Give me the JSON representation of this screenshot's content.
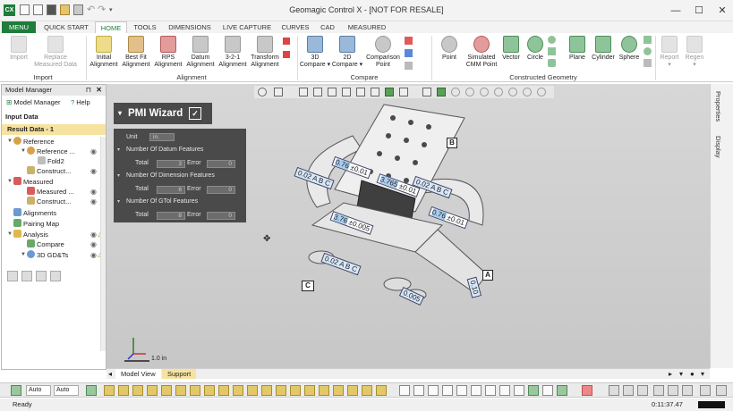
{
  "window": {
    "title": "Geomagic Control X - [NOT FOR RESALE]",
    "app_icon": "CX"
  },
  "tabs": {
    "menu": "MENU",
    "items": [
      "QUICK START",
      "HOME",
      "TOOLS",
      "DIMENSIONS",
      "LIVE CAPTURE",
      "CURVES",
      "CAD",
      "MEASURED"
    ],
    "active": "HOME"
  },
  "ribbon": {
    "import": {
      "label": "Import",
      "buttons": [
        {
          "label1": "Import",
          "label2": ""
        },
        {
          "label1": "Replace",
          "label2": "Measured Data"
        }
      ]
    },
    "alignment": {
      "label": "Alignment",
      "buttons": [
        {
          "label1": "Initial",
          "label2": "Alignment"
        },
        {
          "label1": "Best Fit",
          "label2": "Alignment"
        },
        {
          "label1": "RPS",
          "label2": "Alignment"
        },
        {
          "label1": "Datum",
          "label2": "Alignment"
        },
        {
          "label1": "3-2-1",
          "label2": "Alignment"
        },
        {
          "label1": "Transform",
          "label2": "Alignment"
        }
      ]
    },
    "compare": {
      "label": "Compare",
      "buttons": [
        {
          "label1": "3D",
          "label2": "Compare ▾"
        },
        {
          "label1": "2D",
          "label2": "Compare ▾"
        },
        {
          "label1": "Comparison",
          "label2": "Point"
        }
      ]
    },
    "constructed": {
      "label": "Constructed Geometry",
      "buttons": [
        {
          "label1": "Point",
          "label2": ""
        },
        {
          "label1": "Simulated",
          "label2": "CMM Point"
        },
        {
          "label1": "Vector",
          "label2": ""
        },
        {
          "label1": "Circle",
          "label2": ""
        },
        {
          "label1": "Plane",
          "label2": ""
        },
        {
          "label1": "Cylinder",
          "label2": ""
        },
        {
          "label1": "Sphere",
          "label2": ""
        }
      ]
    },
    "report": {
      "label1": "Report",
      "label2": "▾"
    },
    "regen": {
      "label1": "Regen",
      "label2": "▾"
    }
  },
  "model_manager": {
    "title": "Model Manager",
    "pin": "⊓",
    "close": "✕",
    "tabs": [
      "Model Manager",
      "Help"
    ],
    "input_data": "Input Data",
    "result_data": "Result Data - 1",
    "tree": [
      {
        "label": "Reference",
        "expander": "▼",
        "color": "#d8a24a"
      },
      {
        "label": "Reference ...",
        "expander": "▼",
        "color": "#d8a24a"
      },
      {
        "label": "Fold2",
        "expander": "",
        "color": "#bdbdbd"
      },
      {
        "label": "Construct...",
        "expander": "",
        "color": "#c9b26a"
      },
      {
        "label": "Measured",
        "expander": "▼",
        "color": "#d95c5c"
      },
      {
        "label": "Measured ...",
        "expander": "",
        "color": "#d95c5c"
      },
      {
        "label": "Construct...",
        "expander": "",
        "color": "#c9b26a"
      },
      {
        "label": "Alignments",
        "expander": "",
        "color": "#6a9ad0"
      },
      {
        "label": "Pairing Map",
        "expander": "",
        "color": "#6aa86a"
      },
      {
        "label": "Analysis",
        "expander": "▼",
        "color": "#e0b94a"
      },
      {
        "label": "Compare",
        "expander": "",
        "color": "#6aa86a"
      },
      {
        "label": "3D GD&Ts",
        "expander": "▼",
        "color": "#6a9ad0"
      }
    ]
  },
  "pmi_wizard": {
    "title": "PMI Wizard",
    "check": "✓",
    "unit_label": "Unit",
    "unit_value": "in.",
    "sections": [
      {
        "title": "Number Of Datum Features",
        "total_label": "Total",
        "total": "3",
        "error_label": "Error",
        "error": "0"
      },
      {
        "title": "Number Of Dimension Features",
        "total_label": "Total",
        "total": "6",
        "error_label": "Error",
        "error": "0"
      },
      {
        "title": "Number Of GTol Features",
        "total_label": "Total",
        "total": "8",
        "error_label": "Error",
        "error": "0"
      }
    ]
  },
  "viewport": {
    "scale_label": "1.0 in",
    "annotations": {
      "datum_a": "A",
      "datum_b": "B",
      "datum_c": "C",
      "tol_002": "0.02",
      "tol_076": "0.76",
      "pm001": "±0.01",
      "tol_3765": "3.765",
      "pm0005": "±0.005",
      "tol_376": "3.76",
      "tol_0005": "0.005",
      "tol_010": "0.10",
      "ref_a": "A",
      "ref_b": "B",
      "ref_c": "C"
    }
  },
  "right_panel": {
    "tabs": [
      "Properties",
      "Display"
    ]
  },
  "bottom_tabs": {
    "items": [
      "Model View",
      "Support"
    ]
  },
  "toolbar2": {
    "dropdown1": "Auto",
    "dropdown2": "Auto"
  },
  "status": {
    "ready": "Ready",
    "time": "0:11:37.47"
  }
}
